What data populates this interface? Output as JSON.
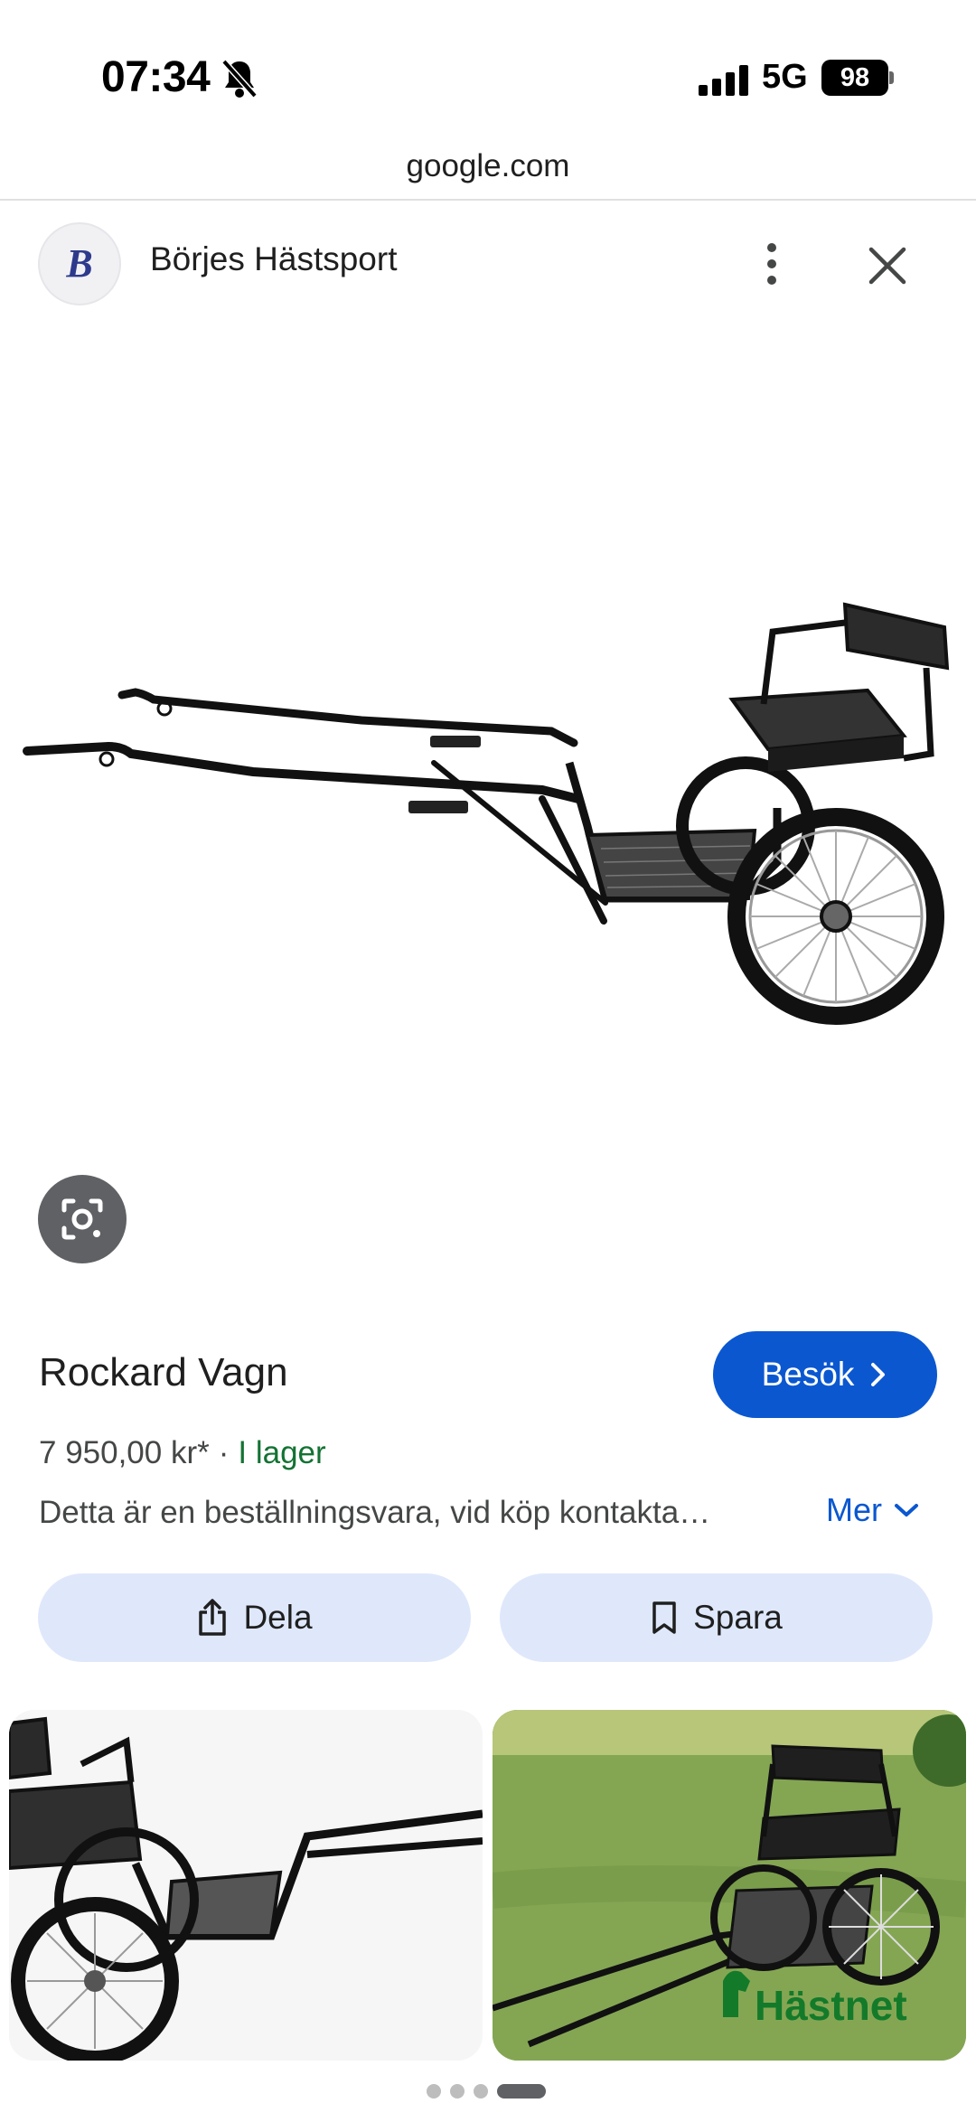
{
  "status_bar": {
    "time": "07:34",
    "network": "5G",
    "battery": "98"
  },
  "browser": {
    "url": "google.com"
  },
  "site": {
    "name": "Börjes Hästsport",
    "logo_letter": "B"
  },
  "product": {
    "title": "Rockard Vagn",
    "price": "7 950,00 kr*",
    "separator": "·",
    "availability": "I lager",
    "description": "Detta är en beställningsvara, vid köp kontakta…",
    "more_label": "Mer",
    "visit_label": "Besök"
  },
  "actions": {
    "share_label": "Dela",
    "save_label": "Spara"
  },
  "related": {
    "watermark": "Hästnet"
  },
  "colors": {
    "accent": "#0b57d0",
    "in_stock": "#137333",
    "chip_bg": "#dfe8fb"
  },
  "icons": [
    "bell-off-icon",
    "signal-icon",
    "more-vert-icon",
    "close-icon",
    "lens-icon",
    "chevron-right-icon",
    "chevron-down-icon",
    "share-icon",
    "bookmark-icon"
  ]
}
